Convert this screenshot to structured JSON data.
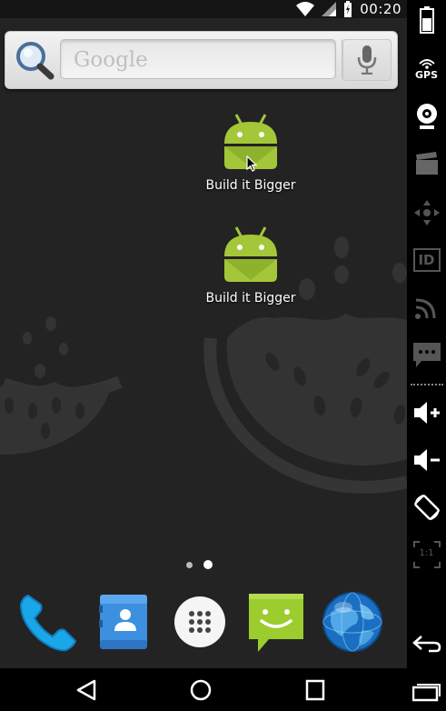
{
  "status_bar": {
    "time": "00:20",
    "icons": [
      "wifi-icon",
      "signal-icon",
      "battery-charging-icon"
    ]
  },
  "search_widget": {
    "placeholder": "Google",
    "icons": [
      "search-icon",
      "mic-icon"
    ]
  },
  "home_apps": [
    {
      "label": "Build it Bigger",
      "icon": "android-icon"
    },
    {
      "label": "Build it Bigger",
      "icon": "android-icon"
    }
  ],
  "page_indicator": {
    "pages": 2,
    "active": 2
  },
  "dock": [
    {
      "name": "Phone",
      "icon": "phone-icon"
    },
    {
      "name": "Contacts",
      "icon": "contacts-icon"
    },
    {
      "name": "App drawer",
      "icon": "app-drawer-icon"
    },
    {
      "name": "Messaging",
      "icon": "messaging-icon"
    },
    {
      "name": "Browser",
      "icon": "globe-icon"
    }
  ],
  "nav_bar": [
    "back-icon",
    "home-icon",
    "recents-icon"
  ],
  "emulator_panel": [
    "battery-icon",
    "gps-icon",
    "camera-icon",
    "video-icon",
    "dpad-icon",
    "id-icon",
    "network-icon",
    "sms-icon",
    "volume-up-icon",
    "volume-down-icon",
    "rotate-icon",
    "scale-icon",
    "back-icon",
    "recents-icon"
  ],
  "panel_labels": {
    "gps": "GPS",
    "id": "ID",
    "scale": "1:1"
  },
  "colors": {
    "android_green": "#a4c639",
    "wallpaper": "#232323",
    "melon": "#3a3a3a"
  }
}
